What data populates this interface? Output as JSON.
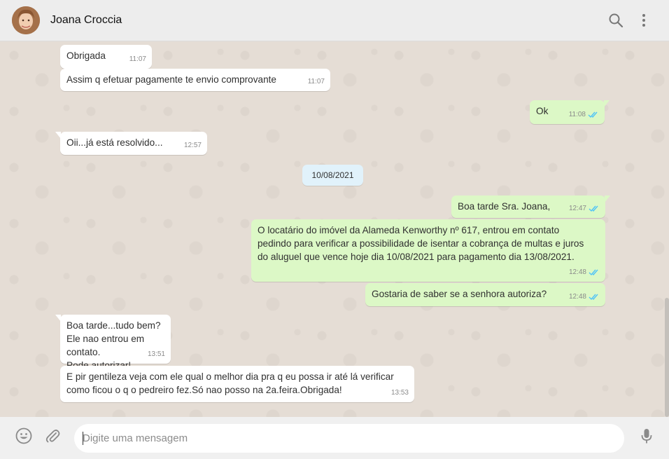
{
  "header": {
    "contact_name": "Joana Croccia",
    "icons": [
      "avatar",
      "search-icon",
      "menu-dots-icon"
    ]
  },
  "messages": [
    {
      "dir": "in",
      "text": "Obrigada",
      "time": "11:07"
    },
    {
      "dir": "in",
      "text": "Assim q efetuar pagamente te envio comprovante",
      "time": "11:07"
    },
    {
      "dir": "out",
      "text": "Ok",
      "time": "11:08",
      "status": "read"
    },
    {
      "dir": "in",
      "text": "Oii...já está resolvido...",
      "time": "12:57"
    },
    {
      "dir": "out",
      "text": "Boa tarde Sra. Joana,",
      "time": "12:47",
      "status": "read"
    },
    {
      "dir": "out",
      "text": "O locatário do imóvel da Alameda Kenworthy nº 617, entrou em contato\npedindo para verificar a possibilidade de isentar a cobrança de multas e juros\ndo aluguel que vence hoje dia 10/08/2021 para pagamento dia 13/08/2021.",
      "time": "12:48",
      "status": "read"
    },
    {
      "dir": "out",
      "text": "Gostaria de saber se a senhora autoriza?",
      "time": "12:48",
      "status": "read"
    },
    {
      "dir": "in",
      "text": "Boa tarde...tudo bem?\nEle nao entrou em contato.\nPode autorizar!",
      "time": "13:51"
    },
    {
      "dir": "in",
      "text": "E pir gentileza veja com ele qual o melhor dia pra q eu possa ir até lá verificar\ncomo ficou o q o pedreiro fez.Só nao posso na 2a.feira.Obrigada!",
      "time": "13:53"
    }
  ],
  "date_separator": "10/08/2021",
  "composer": {
    "placeholder": "Digite uma mensagem",
    "icons": [
      "emoji-icon",
      "attach-clip-icon",
      "microphone-icon"
    ]
  },
  "colors": {
    "outgoing_bubble": "#dcf8c6",
    "incoming_bubble": "#ffffff",
    "read_ticks": "#4fc3f7",
    "date_badge": "#e1f2fb"
  }
}
